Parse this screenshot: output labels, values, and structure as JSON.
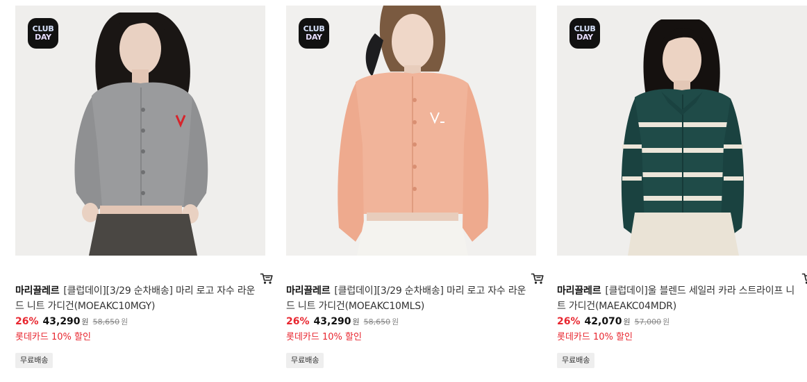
{
  "products": [
    {
      "badge": {
        "line1": "CLUB",
        "line2": "DAY"
      },
      "brand": "마리끌레르",
      "name": "[클럽데이][3/29 순차배송] 마리 로고 자수 라운드 니트 가디건(MOEAKC10MGY)",
      "discount": "26%",
      "price": "43,290",
      "currency": "원",
      "original_price": "58,650",
      "original_currency": "원",
      "promo": "롯데카드 10% 할인",
      "shipping": "무료배송",
      "colors": {
        "cardigan": "#9a9b9d",
        "background": "#efeeec",
        "pants": "#4a4743",
        "hair": "#1a1614"
      }
    },
    {
      "badge": {
        "line1": "CLUB",
        "line2": "DAY"
      },
      "brand": "마리끌레르",
      "name": "[클럽데이][3/29 순차배송] 마리 로고 자수 라운드 니트 가디건(MOEAKC10MLS)",
      "discount": "26%",
      "price": "43,290",
      "currency": "원",
      "original_price": "58,650",
      "original_currency": "원",
      "promo": "롯데카드 10% 할인",
      "shipping": "무료배송",
      "colors": {
        "cardigan": "#f1b49a",
        "background": "#f1f0ee",
        "pants": "#f4f3ef",
        "hair": "#7a5a40"
      }
    },
    {
      "badge": {
        "line1": "CLUB",
        "line2": "DAY"
      },
      "brand": "마리끌레르",
      "name": "[클럽데이]울 블렌드 세일러 카라 스트라이프 니트 가디건(MAEAKC04MDR)",
      "discount": "26%",
      "price": "42,070",
      "currency": "원",
      "original_price": "57,000",
      "original_currency": "원",
      "promo": "롯데카드 10% 할인",
      "shipping": "무료배송",
      "colors": {
        "cardigan": "#1f4b48",
        "background": "#efeeec",
        "pants": "#eae3d6",
        "hair": "#15110f"
      }
    }
  ]
}
